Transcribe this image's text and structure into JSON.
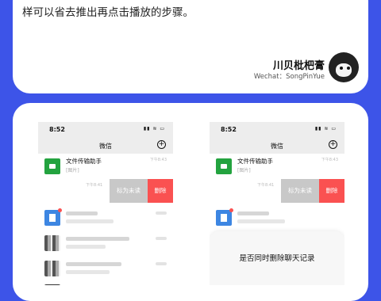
{
  "intro": {
    "text": "样可以省去推出再点击播放的步骤。"
  },
  "author": {
    "name": "川贝枇杷膏",
    "wechat": "Wechat：SongPinYue"
  },
  "phones": [
    {
      "status_time": "8:52",
      "title": "微信",
      "chat1": {
        "name": "文件传输助手",
        "subtitle": "[图片]",
        "time": "下午8:43"
      },
      "swipe_row": {
        "time": "下午8:41",
        "mark_label": "标为未读",
        "delete_label": "删除"
      }
    },
    {
      "status_time": "8:52",
      "title": "微信",
      "chat1": {
        "name": "文件传输助手",
        "subtitle": "[图片]",
        "time": "下午8:43"
      },
      "swipe_row": {
        "time": "下午8:41",
        "mark_label": "标为未读",
        "delete_label": "删除"
      },
      "sheet": {
        "text": "是否同时删除聊天记录"
      }
    }
  ]
}
